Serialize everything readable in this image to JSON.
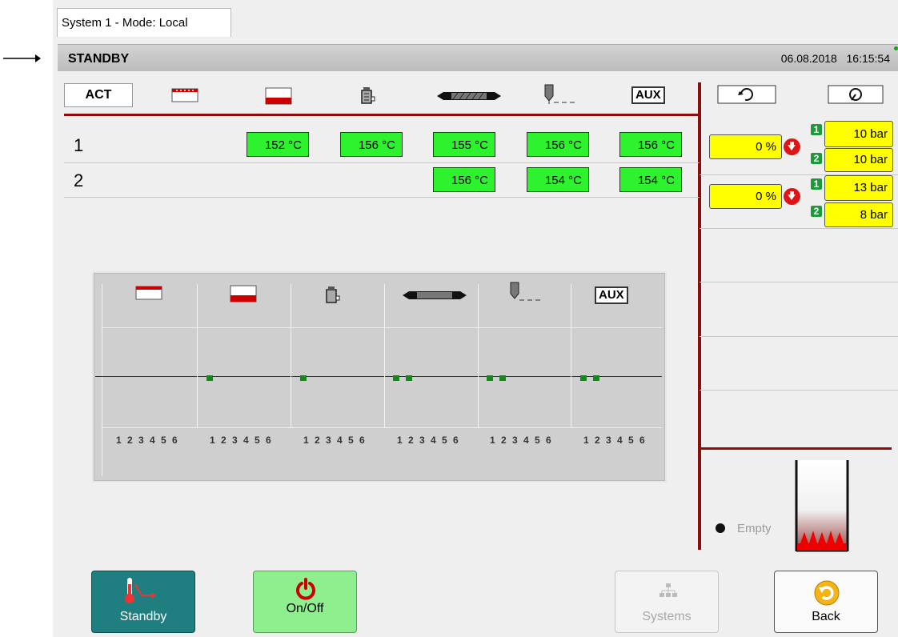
{
  "tab": {
    "label": "System 1 - Mode: Local"
  },
  "status": {
    "state": "STANDBY",
    "date": "06.08.2018",
    "time": "16:15:54"
  },
  "header": {
    "act_label": "ACT",
    "aux_label": "AUX",
    "icons": [
      "manifold-heater-icon",
      "nozzle-tip-heater-icon",
      "filter-canister-icon",
      "screw-barrel-icon",
      "nozzle-probe-icon",
      "aux-icon",
      "refresh-icon",
      "pressure-gauge-icon"
    ]
  },
  "zones": {
    "row1": {
      "label": "1",
      "temps": [
        "152 °C",
        "156 °C",
        "155 °C",
        "156 °C",
        "156 °C"
      ]
    },
    "row2": {
      "label": "2",
      "temps": [
        "156 °C",
        "154 °C",
        "154 °C"
      ]
    }
  },
  "pressure": {
    "unit1": {
      "percent": "0 %",
      "p1": "10 bar",
      "p2": "10 bar"
    },
    "unit2": {
      "percent": "0 %",
      "p1": "13 bar",
      "p2": "8 bar"
    },
    "badge1": "1",
    "badge2": "2"
  },
  "graph": {
    "channel_numbers": "1 2 3 4 5 6",
    "columns": [
      "manifold",
      "nozzle-tip",
      "filter",
      "barrel",
      "probe",
      "aux"
    ]
  },
  "tank": {
    "empty_label": "Empty"
  },
  "buttons": {
    "standby": "Standby",
    "onoff": "On/Off",
    "systems": "Systems",
    "back": "Back"
  },
  "colors": {
    "accent_red": "#8b0d0d",
    "temp_green": "#2df22d",
    "value_yellow": "#fefe00",
    "standby_teal": "#1f7f80"
  }
}
